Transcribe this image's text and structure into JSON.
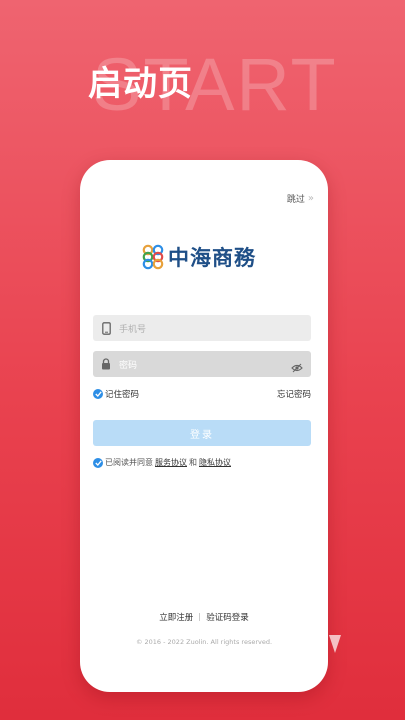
{
  "background_word": "START",
  "hero_title": "启动页",
  "skip": {
    "label": "跳过",
    "chevron": "»"
  },
  "logo": {
    "text": "中海商務"
  },
  "phone_field": {
    "placeholder": "手机号"
  },
  "password_field": {
    "placeholder": "密码"
  },
  "remember": {
    "label": "记住密码",
    "checked": true
  },
  "forgot": {
    "label": "忘记密码"
  },
  "login_button": {
    "label": "登录"
  },
  "agreement": {
    "prefix": "已阅读并同意",
    "service_link": "服务协议",
    "conj": "和",
    "privacy_link": "隐私协议",
    "checked": true
  },
  "bottom_links": {
    "register": "立即注册",
    "code_login": "验证码登录"
  },
  "copyright": "© 2016 - 2022 Zuolin. All rights reserved.",
  "colors": {
    "accent": "#2d8ee6",
    "background": "#e9424f",
    "logo": "#1f4f87",
    "login_button": "#b9dcf7"
  }
}
